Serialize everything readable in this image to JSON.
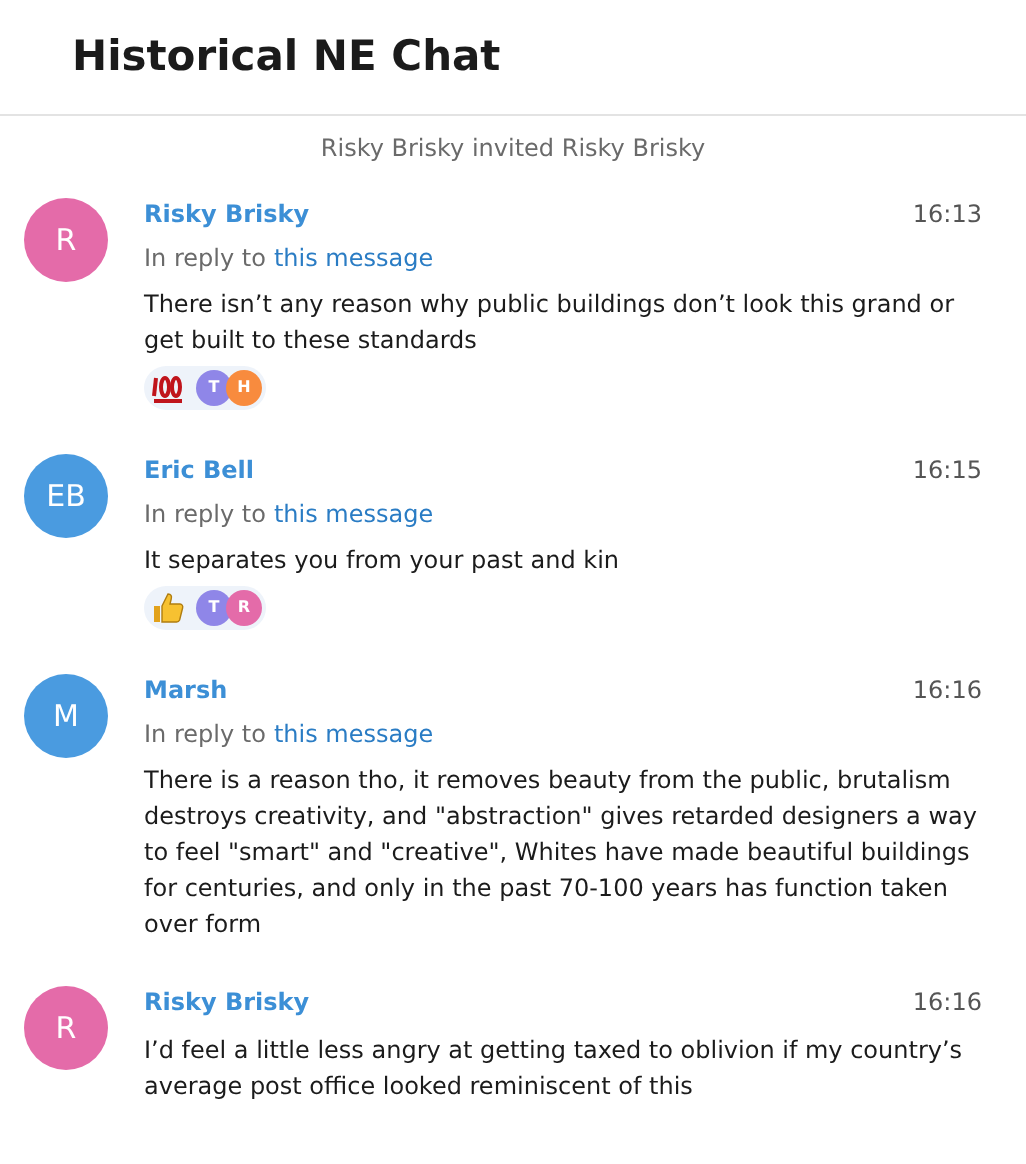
{
  "chat": {
    "title": "Historical NE Chat"
  },
  "events": [
    {
      "kind": "notice",
      "text": "Risky Brisky invited Risky Brisky"
    }
  ],
  "messages": [
    {
      "avatar": {
        "initials": "R",
        "color": "#e46ba9"
      },
      "sender": "Risky Brisky",
      "time": "16:13",
      "reply_prefix": "In reply to",
      "reply_link": "this message",
      "text": "There isn’t any reason why public buildings don’t look this grand or get built to these standards",
      "reaction": {
        "kind": "hundred",
        "users": [
          {
            "initial": "T",
            "color": "#8f86e8"
          },
          {
            "initial": "H",
            "color": "#f88b3e"
          }
        ]
      }
    },
    {
      "avatar": {
        "initials": "EB",
        "color": "#4a9be0"
      },
      "sender": "Eric Bell",
      "time": "16:15",
      "reply_prefix": "In reply to",
      "reply_link": "this message",
      "text": "It separates you from your past and kin",
      "reaction": {
        "kind": "thumbs_up",
        "users": [
          {
            "initial": "T",
            "color": "#8f86e8"
          },
          {
            "initial": "R",
            "color": "#e46ba9"
          }
        ]
      }
    },
    {
      "avatar": {
        "initials": "M",
        "color": "#4a9be0"
      },
      "sender": "Marsh",
      "time": "16:16",
      "reply_prefix": "In reply to",
      "reply_link": "this message",
      "text": "There is a reason tho, it removes beauty from the public, brutalism destroys creativity, and \"abstraction\" gives retarded designers a way to feel \"smart\" and \"creative\", Whites have made beautiful buildings for centuries, and only in the past 70-100 years has function taken over form"
    },
    {
      "avatar": {
        "initials": "R",
        "color": "#e46ba9"
      },
      "sender": "Risky Brisky",
      "time": "16:16",
      "text": "I’d feel a little less angry at getting taxed to oblivion if my country’s average post office looked reminiscent of this"
    }
  ]
}
